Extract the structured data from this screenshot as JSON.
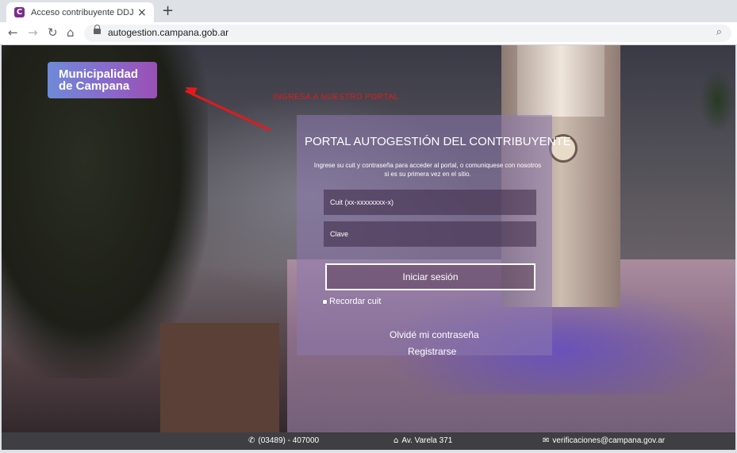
{
  "browser": {
    "tab_title": "Acceso contribuyente DDJJ | Cam",
    "favicon_letter": "C",
    "url": "autogestion.campana.gob.ar"
  },
  "page": {
    "logo": {
      "line1": "Municipalidad",
      "line2": "de Campana"
    },
    "annotation": "INGRESA A NUESTRO PORTAL",
    "panel": {
      "title": "PORTAL AUTOGESTIÓN DEL CONTRIBUYENTE",
      "description": "Ingrese su cuit y contraseña para acceder al portal, o comuniquese con nosotros si es su primera vez en el sitio.",
      "cuit_placeholder": "Cuit (xx-xxxxxxxx-x)",
      "password_placeholder": "Clave",
      "login_button": "Iniciar sesión",
      "remember_label": "Recordar cuit",
      "forgot_link": "Olvidé mi contraseña",
      "register_link": "Registrarse"
    },
    "footer": {
      "phone": "(03489) - 407000",
      "address": "Av. Varela 371",
      "email": "verificaciones@campana.gov.ar"
    }
  },
  "colors": {
    "annotation": "#e11b1b",
    "logo_start": "#6f8ad8",
    "logo_end": "#9b4fb3",
    "panel": "#8c78af"
  }
}
